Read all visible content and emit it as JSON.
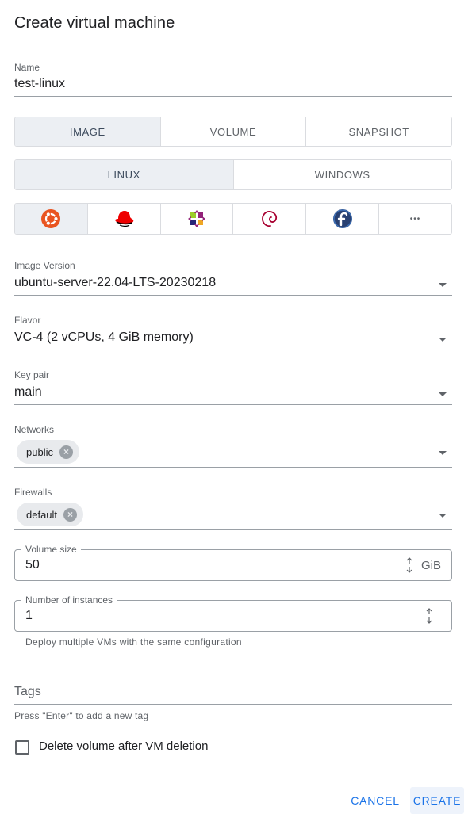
{
  "dialog": {
    "title": "Create virtual machine"
  },
  "name_field": {
    "label": "Name",
    "value": "test-linux"
  },
  "source_tabs": [
    {
      "label": "IMAGE",
      "active": true
    },
    {
      "label": "VOLUME",
      "active": false
    },
    {
      "label": "SNAPSHOT",
      "active": false
    }
  ],
  "os_tabs": [
    {
      "label": "LINUX",
      "active": true
    },
    {
      "label": "WINDOWS",
      "active": false
    }
  ],
  "distros": [
    {
      "icon": "ubuntu-icon",
      "active": true
    },
    {
      "icon": "redhat-icon",
      "active": false
    },
    {
      "icon": "centos-icon",
      "active": false
    },
    {
      "icon": "debian-icon",
      "active": false
    },
    {
      "icon": "fedora-icon",
      "active": false
    },
    {
      "icon": "more-icon",
      "active": false,
      "glyph": "•••"
    }
  ],
  "image_version": {
    "label": "Image Version",
    "value": "ubuntu-server-22.04-LTS-20230218"
  },
  "flavor": {
    "label": "Flavor",
    "value": "VC-4 (2 vCPUs, 4 GiB memory)"
  },
  "key_pair": {
    "label": "Key pair",
    "value": "main"
  },
  "networks": {
    "label": "Networks",
    "chips": [
      "public"
    ]
  },
  "firewalls": {
    "label": "Firewalls",
    "chips": [
      "default"
    ]
  },
  "volume_size": {
    "label": "Volume size",
    "value": "50",
    "unit": "GiB"
  },
  "instances": {
    "label": "Number of instances",
    "value": "1",
    "helper": "Deploy multiple VMs with the same configuration"
  },
  "tags": {
    "placeholder": "Tags",
    "helper": "Press \"Enter\" to add a new tag"
  },
  "delete_volume": {
    "label": "Delete volume after VM deletion",
    "checked": false
  },
  "actions": {
    "cancel": "CANCEL",
    "create": "CREATE"
  },
  "colors": {
    "accent": "#1a73e8",
    "active_tab_bg": "#eceff3",
    "ubuntu": "#e95420",
    "redhat": "#ee0000",
    "debian": "#a80030",
    "fedora": "#294172"
  }
}
